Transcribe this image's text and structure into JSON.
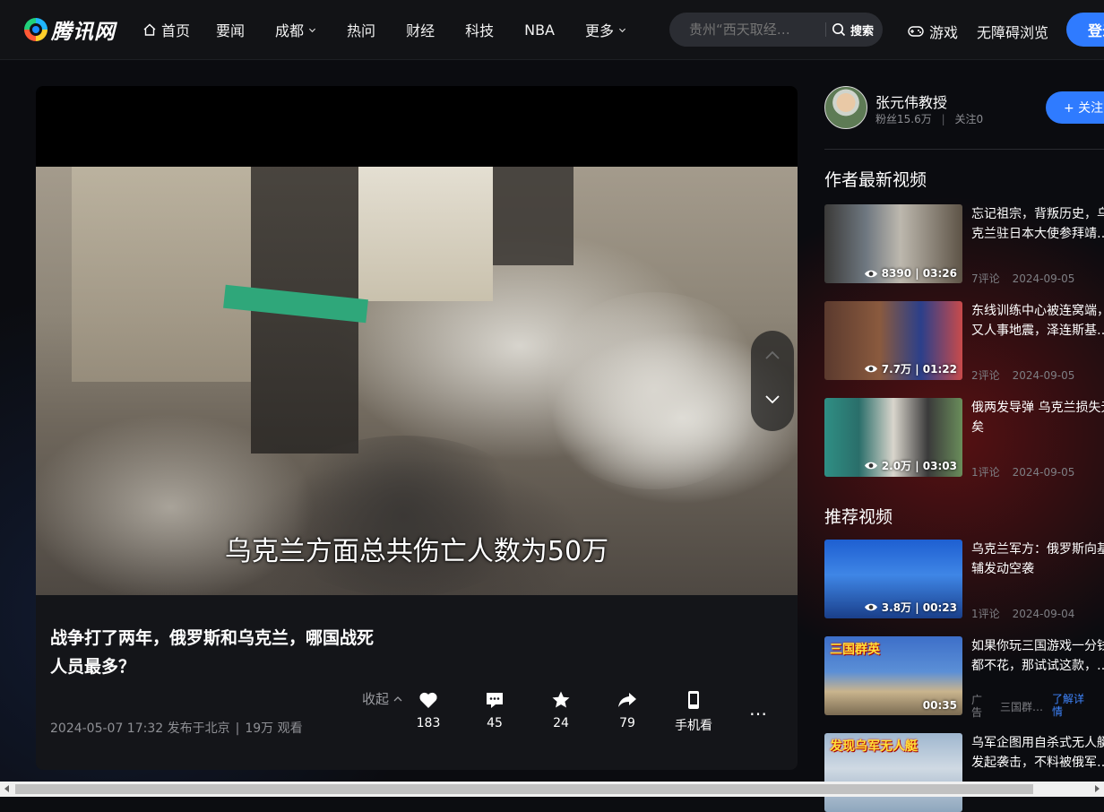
{
  "header": {
    "logo_text": "腾讯网",
    "nav": [
      {
        "label": "首页",
        "icon": "home-icon"
      },
      {
        "label": "要闻"
      },
      {
        "label": "成都",
        "dropdown": true
      },
      {
        "label": "热问"
      },
      {
        "label": "财经"
      },
      {
        "label": "科技"
      },
      {
        "label": "NBA"
      },
      {
        "label": "更多",
        "dropdown": true
      }
    ],
    "search_placeholder": "贵州“西天取经…",
    "search_button": "搜索",
    "games_label": "游戏",
    "accessibility_label": "无障碍浏览",
    "login_label": "登录"
  },
  "player": {
    "subtitle": "乌克兰方面总共伤亡人数为50万",
    "title_line1": "战争打了两年，俄罗斯和乌克兰，哪国战死",
    "title_line2": "人员最多？",
    "collapse_label": "收起",
    "publish_time": "2024-05-07 17:32 发布于北京",
    "views": "19万 观看",
    "actions": [
      {
        "icon": "heart-icon",
        "label": "183"
      },
      {
        "icon": "comment-icon",
        "label": "45"
      },
      {
        "icon": "star-icon",
        "label": "24"
      },
      {
        "icon": "share-icon",
        "label": "79"
      },
      {
        "icon": "phone-icon",
        "label": "手机看"
      }
    ],
    "more_label": "…"
  },
  "author": {
    "name": "张元伟教授",
    "fans": "粉丝15.6万",
    "following": "关注0",
    "follow_label": "+ 关注"
  },
  "sections": {
    "latest_title": "作者最新视频",
    "recommend_title": "推荐视频"
  },
  "latest_videos": [
    {
      "title_l1": "忘记祖宗，背叛历史，乌",
      "title_l2": "克兰驻日本大使参拜靖…",
      "stats": "8390 | 03:26",
      "comments": "7评论",
      "date": "2024-09-05"
    },
    {
      "title_l1": "东线训练中心被连窝端，",
      "title_l2": "又人事地震，泽连斯基…",
      "stats": "7.7万 | 01:22",
      "comments": "2评论",
      "date": "2024-09-05"
    },
    {
      "title_l1": "俄两发导弹 乌克兰损失无",
      "title_l2": "矣",
      "stats": "2.0万 | 03:03",
      "comments": "1评论",
      "date": "2024-09-05"
    }
  ],
  "recommended_videos": [
    {
      "title_l1": "乌克兰军方：俄罗斯向基",
      "title_l2": "辅发动空袭",
      "stats": "3.8万 | 00:23",
      "comments": "1评论",
      "date": "2024-09-04"
    },
    {
      "title_l1": "如果你玩三国游戏一分钱",
      "title_l2": "都不花，那试试这款，…",
      "duration": "00:35",
      "ad_tag": "广告",
      "ad_source": "三国群…",
      "ad_more": "了解详情",
      "caption": "三国群英"
    },
    {
      "title_l1": "乌军企图用自杀式无人艇",
      "title_l2": "发起袭击，不料被俄军…",
      "caption": "发现乌军无人艇"
    }
  ]
}
